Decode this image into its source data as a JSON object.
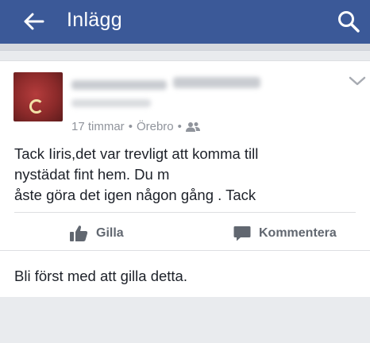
{
  "appbar": {
    "title": "Inlägg",
    "back_icon": "arrow-left-icon",
    "search_icon": "search-icon",
    "color": "#3b5998"
  },
  "post": {
    "time": "17 timmar",
    "separator": "•",
    "location": "Örebro",
    "audience_icon": "friends-icon",
    "text_lines": [
      "Tack Iiris,det var trevligt att komma till",
      "nystädat fint hem. Du m",
      "åste göra det igen någon gång . Tack"
    ],
    "menu_icon": "chevron-down-icon"
  },
  "actions": {
    "like_label": "Gilla",
    "comment_label": "Kommentera"
  },
  "likes_summary": "Bli först med att gilla detta."
}
